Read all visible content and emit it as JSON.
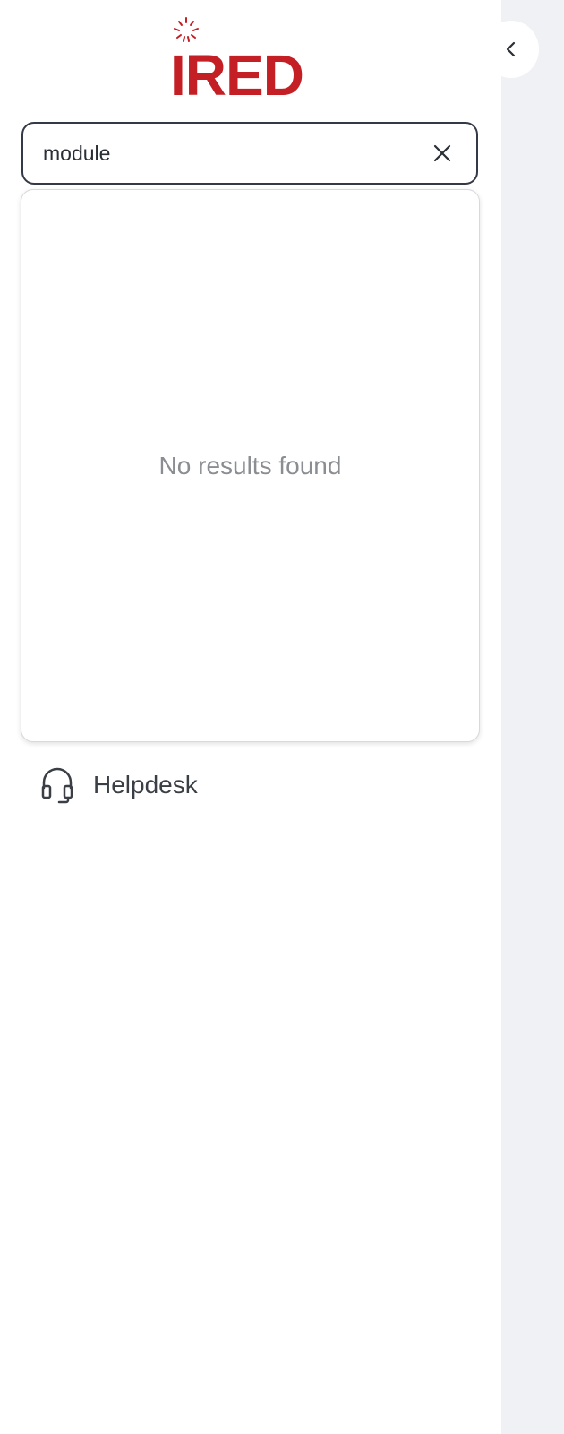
{
  "brand": {
    "logo_text": "IRED",
    "logo_color": "#c41f24"
  },
  "sidebar_toggle": {
    "icon": "chevron-left-icon"
  },
  "search": {
    "value": "module",
    "clear_icon": "close-icon"
  },
  "results": {
    "empty_message": "No results found"
  },
  "nav": {
    "helpdesk_label": "Helpdesk",
    "helpdesk_icon": "headset-icon"
  },
  "colors": {
    "main_background": "#f0f1f5",
    "text": "#3a3f46",
    "muted_text": "#8a8d92"
  }
}
